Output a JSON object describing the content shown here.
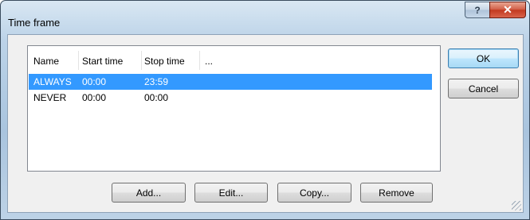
{
  "window": {
    "title": "Time frame",
    "help_glyph": "?",
    "close_glyph": "✕"
  },
  "list": {
    "columns": [
      "Name",
      "Start time",
      "Stop time",
      "..."
    ],
    "rows": [
      {
        "name": "ALWAYS",
        "start": "00:00",
        "stop": "23:59",
        "selected": true
      },
      {
        "name": "NEVER",
        "start": "00:00",
        "stop": "00:00",
        "selected": false
      }
    ]
  },
  "buttons": {
    "ok": "OK",
    "cancel": "Cancel",
    "add": "Add...",
    "edit": "Edit...",
    "copy": "Copy...",
    "remove": "Remove"
  },
  "colors": {
    "selection": "#3399ff",
    "close_button": "#c23a20"
  }
}
